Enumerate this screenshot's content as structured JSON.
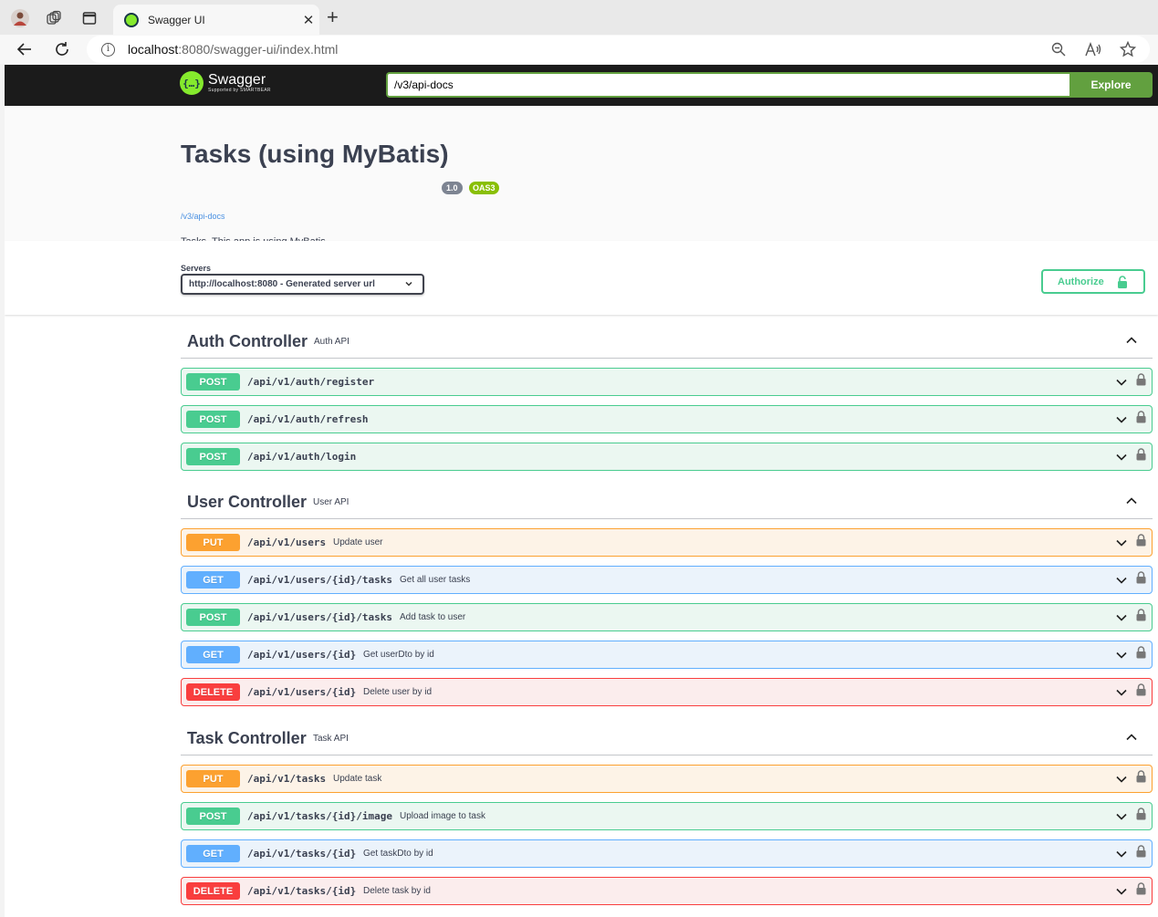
{
  "browser": {
    "tab_title": "Swagger UI",
    "url_host": "localhost",
    "url_rest": ":8080/swagger-ui/index.html"
  },
  "topbar": {
    "logo_name": "Swagger",
    "logo_sub": "Supported by SMARTBEAR",
    "spec_url": "/v3/api-docs",
    "explore_label": "Explore"
  },
  "info": {
    "title": "Tasks (using MyBatis)",
    "version": "1.0",
    "oas": "OAS3",
    "link": "/v3/api-docs",
    "description": "Tasks. This app is using MyBatis"
  },
  "scheme": {
    "servers_label": "Servers",
    "server_selected": "http://localhost:8080 - Generated server url",
    "authorize_label": "Authorize"
  },
  "tags": [
    {
      "name": "Auth Controller",
      "description": "Auth API",
      "operations": [
        {
          "method": "POST",
          "path": "/api/v1/auth/register",
          "summary": ""
        },
        {
          "method": "POST",
          "path": "/api/v1/auth/refresh",
          "summary": ""
        },
        {
          "method": "POST",
          "path": "/api/v1/auth/login",
          "summary": ""
        }
      ]
    },
    {
      "name": "User Controller",
      "description": "User API",
      "operations": [
        {
          "method": "PUT",
          "path": "/api/v1/users",
          "summary": "Update user"
        },
        {
          "method": "GET",
          "path": "/api/v1/users/{id}/tasks",
          "summary": "Get all user tasks"
        },
        {
          "method": "POST",
          "path": "/api/v1/users/{id}/tasks",
          "summary": "Add task to user"
        },
        {
          "method": "GET",
          "path": "/api/v1/users/{id}",
          "summary": "Get userDto by id"
        },
        {
          "method": "DELETE",
          "path": "/api/v1/users/{id}",
          "summary": "Delete user by id"
        }
      ]
    },
    {
      "name": "Task Controller",
      "description": "Task API",
      "operations": [
        {
          "method": "PUT",
          "path": "/api/v1/tasks",
          "summary": "Update task"
        },
        {
          "method": "POST",
          "path": "/api/v1/tasks/{id}/image",
          "summary": "Upload image to task"
        },
        {
          "method": "GET",
          "path": "/api/v1/tasks/{id}",
          "summary": "Get taskDto by id"
        },
        {
          "method": "DELETE",
          "path": "/api/v1/tasks/{id}",
          "summary": "Delete task by id"
        }
      ]
    }
  ],
  "colors": {
    "post": "#49cc90",
    "put": "#fca130",
    "get": "#61affe",
    "delete": "#f93e3e",
    "topbar": "#1b1b1b",
    "explore": "#62a03f"
  }
}
